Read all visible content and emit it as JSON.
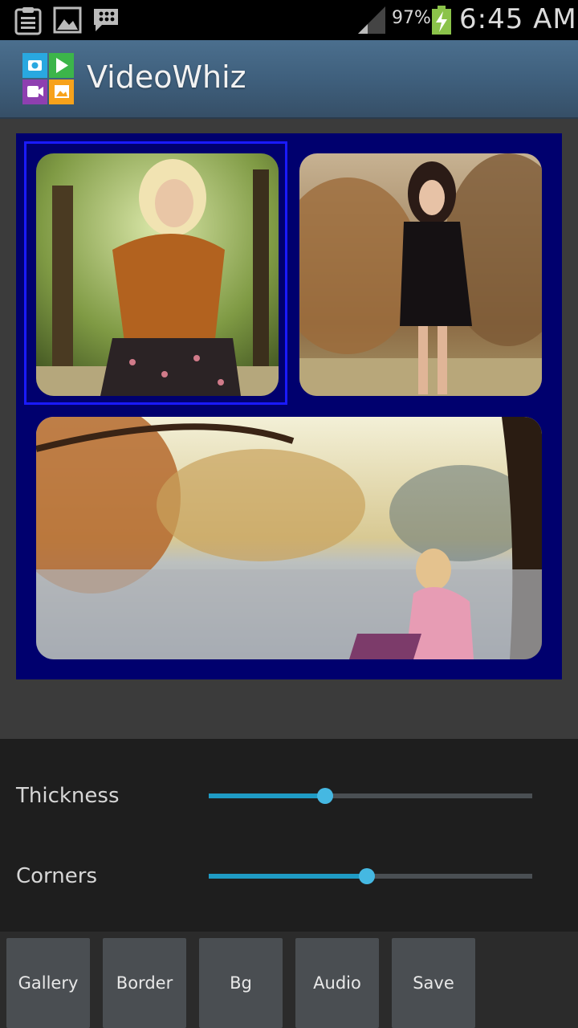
{
  "status_bar": {
    "battery_percent": "97%",
    "time": "6:45 AM",
    "icons": [
      "clipboard-icon",
      "image-icon",
      "bbm-icon",
      "signal-icon",
      "battery-charging-icon"
    ]
  },
  "app": {
    "title": "VideoWhiz",
    "logo_icon": "videowhiz-logo-icon"
  },
  "collage": {
    "background_color": "#00006e",
    "selected_cell": 1,
    "cells": [
      "photo-woman-scarf",
      "photo-woman-black-dress",
      "photo-girl-by-lake"
    ]
  },
  "controls": {
    "thickness": {
      "label": "Thickness",
      "value": 0.36
    },
    "corners": {
      "label": "Corners",
      "value": 0.49
    }
  },
  "buttons": {
    "gallery": "Gallery",
    "border": "Border",
    "bg": "Bg",
    "audio": "Audio",
    "save": "Save"
  }
}
